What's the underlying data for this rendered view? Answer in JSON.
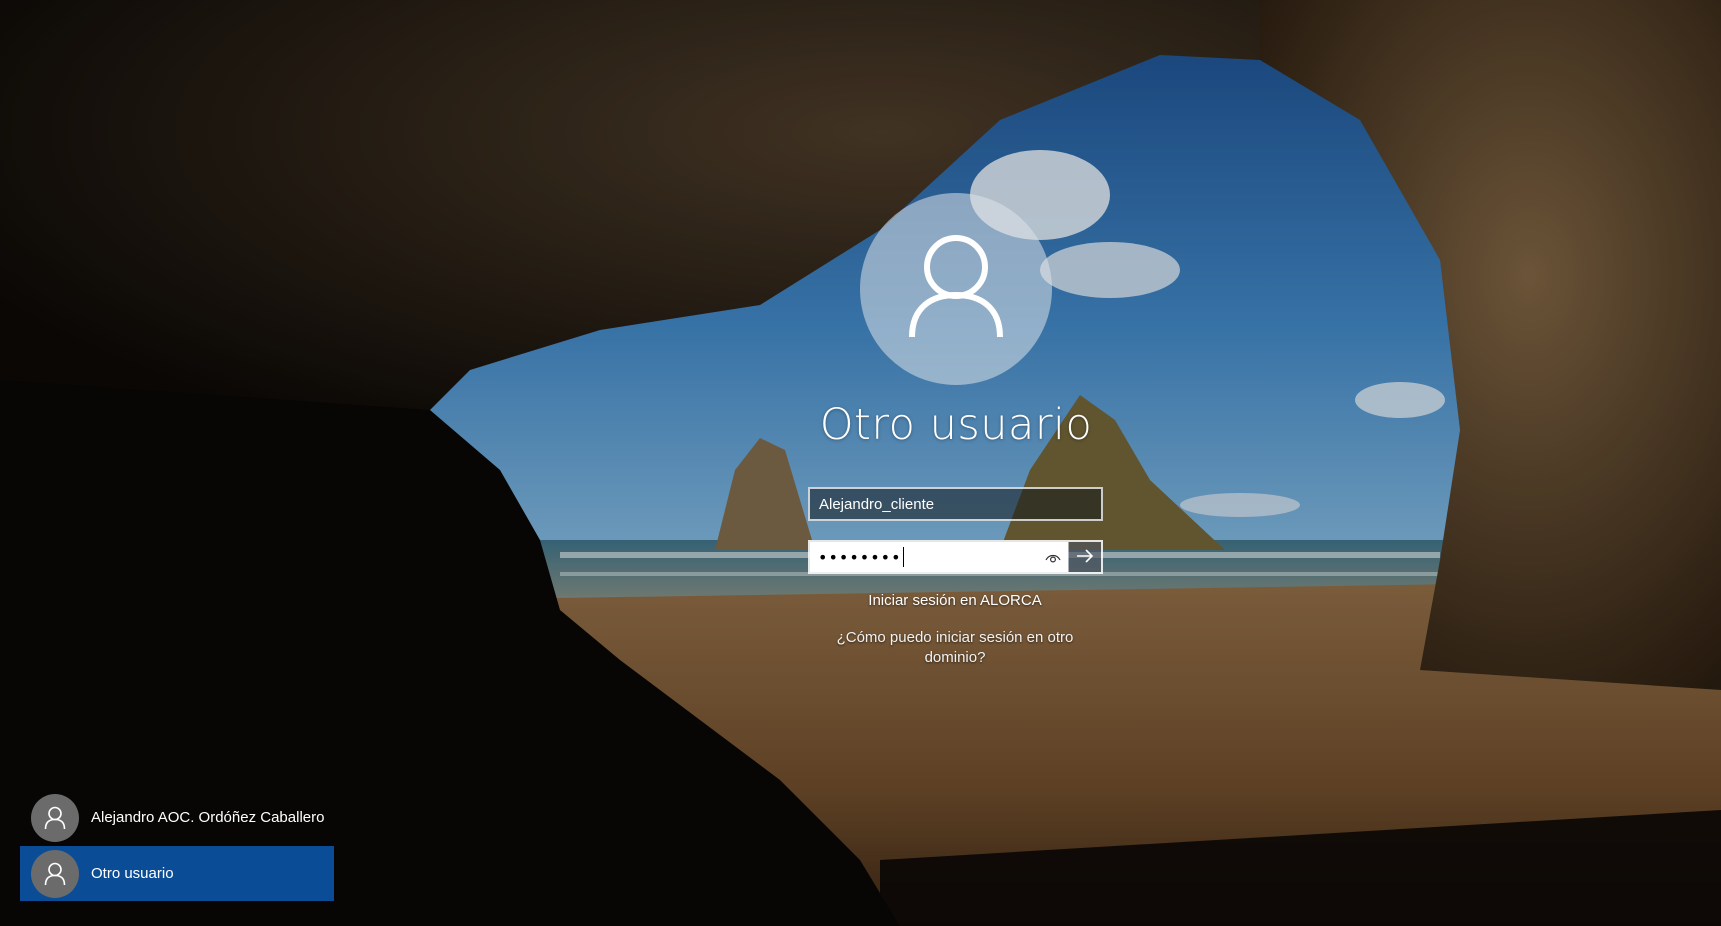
{
  "lock_screen": {
    "username_title": "Otro usuario",
    "avatar_icon": "user-silhouette-icon"
  },
  "login_form": {
    "username_value": "Alejandro_cliente",
    "password_masked": "••••••••",
    "reveal_icon": "eye-icon",
    "submit_icon": "arrow-right-icon",
    "domain_text": "Iniciar sesión en ALORCA",
    "help_link": "¿Cómo puedo iniciar sesión en otro dominio?"
  },
  "user_list": {
    "items": [
      {
        "name": "Alejandro AOC. Ordóñez Caballero",
        "selected": false,
        "icon": "user-avatar-icon"
      },
      {
        "name": "Otro usuario",
        "selected": true,
        "icon": "user-avatar-icon"
      }
    ]
  },
  "colors": {
    "selected_item": "#0a4d96",
    "avatar_small": "#6b6b6b"
  }
}
